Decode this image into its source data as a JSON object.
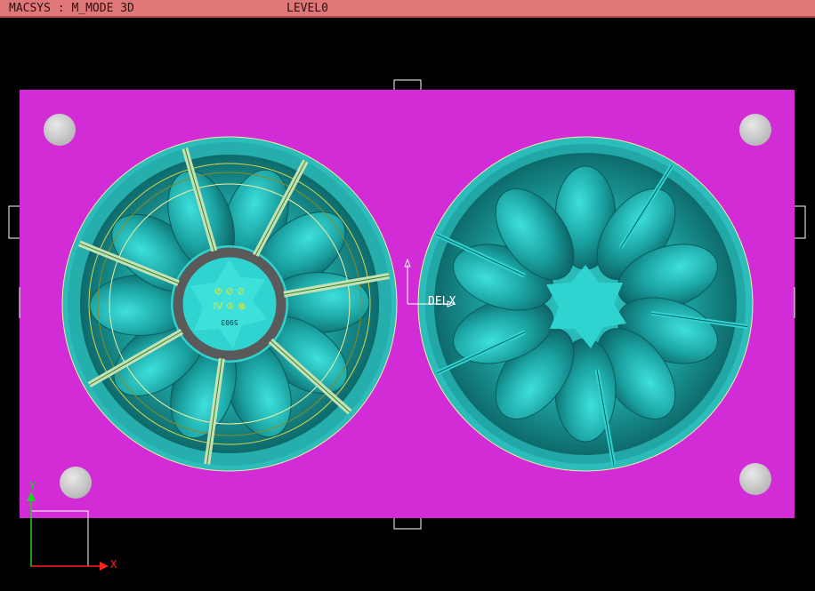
{
  "titlebar": {
    "app_mode": "MACSYS : M_MODE 3D",
    "level": "LEVEL0"
  },
  "viewport": {
    "origin_label": "DELX",
    "axis_x_label": "X",
    "axis_y_label": "Y",
    "cavity_marking_top": "⊘ ⊘ ⊘",
    "cavity_marking_mid": "lⅤ ♔ ⊗",
    "cavity_marking_bottom": "5903"
  },
  "colors": {
    "background": "#000000",
    "plate": "#d22cd6",
    "cavity": "#22b3b1",
    "cavity_light": "#2fd3d0",
    "cavity_dark": "#0f6f70",
    "titlebar": "#e0787a",
    "outline": "#f0f0a0",
    "axis_x": "#ff2020",
    "axis_y": "#20d020"
  }
}
